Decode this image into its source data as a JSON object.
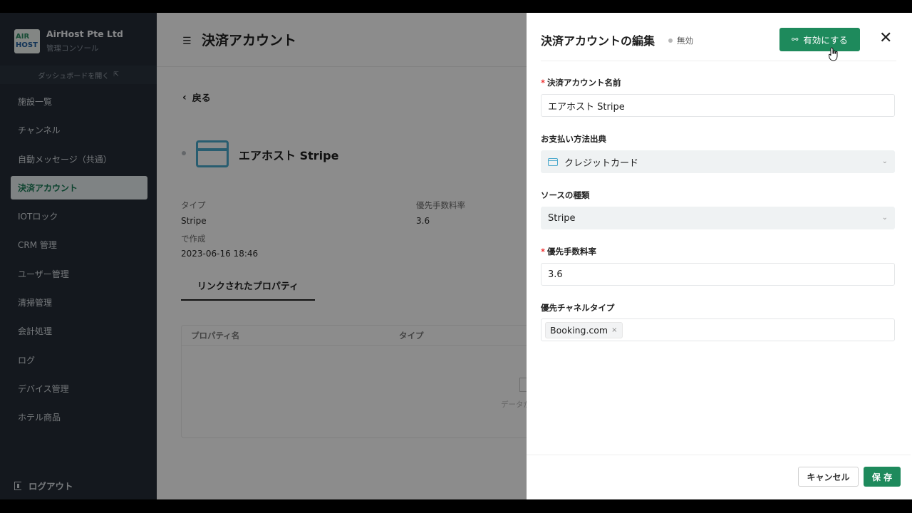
{
  "sidebar": {
    "org_name": "AirHost Pte Ltd",
    "org_sub": "管理コンソール",
    "logo_top": "AIR",
    "logo_bottom": "HOST",
    "dashboard_link": "ダッシュボードを開く",
    "items": [
      {
        "label": "施設一覧"
      },
      {
        "label": "チャンネル"
      },
      {
        "label": "自動メッセージ（共通）"
      },
      {
        "label": "決済アカウント",
        "active": true
      },
      {
        "label": "IOTロック"
      },
      {
        "label": "CRM 管理"
      },
      {
        "label": "ユーザー管理"
      },
      {
        "label": "清掃管理"
      },
      {
        "label": "会計処理"
      },
      {
        "label": "ログ"
      },
      {
        "label": "デバイス管理"
      },
      {
        "label": "ホテル商品"
      }
    ],
    "logout": "ログアウト"
  },
  "main": {
    "page_title": "決済アカウント",
    "back": "戻る",
    "account_name": "エアホスト Stripe",
    "type_label": "タイプ",
    "type_value": "Stripe",
    "fee_label": "優先手数料率",
    "fee_value": "3.6",
    "created_label": "で作成",
    "created_value": "2023-06-16 18:46",
    "tab": "リンクされたプロパティ",
    "col_property": "プロパティ名",
    "col_type": "タイプ",
    "empty": "データが"
  },
  "drawer": {
    "title": "決済アカウントの編集",
    "status": "無効",
    "enable_button": "有効にする",
    "fields": {
      "name_label": "決済アカウント名前",
      "name_value": "エアホスト Stripe",
      "payment_label": "お支払い方法出典",
      "payment_value": "クレジットカード",
      "source_label": "ソースの種類",
      "source_value": "Stripe",
      "fee_label": "優先手数料率",
      "fee_value": "3.6",
      "channel_label": "優先チャネルタイプ",
      "channel_tag": "Booking.com"
    },
    "cancel": "キャンセル",
    "save": "保 存"
  },
  "colors": {
    "primary": "#1e8a5c",
    "sidebar_bg": "#252d37",
    "accent_blue": "#4aa9cc"
  }
}
